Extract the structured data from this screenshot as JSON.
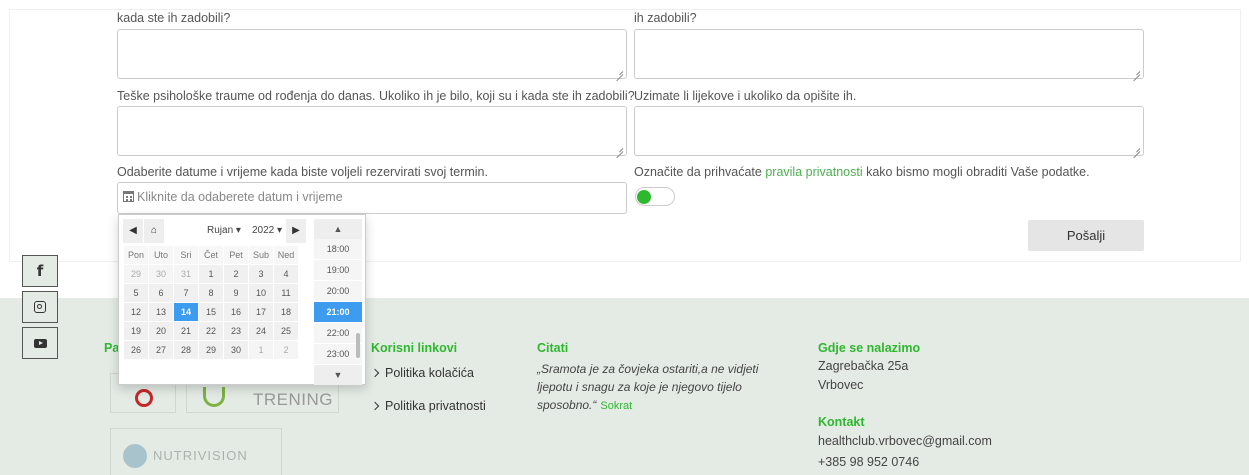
{
  "form": {
    "label_1": "kada ste ih zadobili?",
    "label_2": "ih zadobili?",
    "label_3": "Teške psihološke traume od rođenja do danas. Ukoliko ih je bilo, koji su i kada ste ih zadobili?",
    "label_4": "Uzimate li lijekove i ukoliko da opišite ih.",
    "date_label": "Odaberite datume i vrijeme kada biste voljeli rezervirati svoj termin.",
    "date_placeholder": "Kliknite da odaberete datum i vrijeme",
    "privacy_pre": "Označite da prihvaćate",
    "privacy_link": "pravila privatnosti",
    "privacy_post": "kako bismo mogli obraditi Vaše podatke.",
    "toggle_on": true,
    "submit_label": "Pošalji"
  },
  "datepicker": {
    "month": "Rujan",
    "year": "2022",
    "weekdays": [
      "Pon",
      "Uto",
      "Sri",
      "Čet",
      "Pet",
      "Sub",
      "Ned"
    ],
    "weeks": [
      [
        "29",
        "30",
        "31",
        "1",
        "2",
        "3",
        "4"
      ],
      [
        "5",
        "6",
        "7",
        "8",
        "9",
        "10",
        "11"
      ],
      [
        "12",
        "13",
        "14",
        "15",
        "16",
        "17",
        "18"
      ],
      [
        "19",
        "20",
        "21",
        "22",
        "23",
        "24",
        "25"
      ],
      [
        "26",
        "27",
        "28",
        "29",
        "30",
        "1",
        "2"
      ]
    ],
    "selected_day": "14",
    "times": [
      "18:00",
      "19:00",
      "20:00",
      "21:00",
      "22:00",
      "23:00"
    ],
    "selected_time": "21:00"
  },
  "social": [
    "facebook-icon",
    "instagram-icon",
    "youtube-icon"
  ],
  "footer": {
    "partners_heading": "Pa",
    "links_heading": "Korisni linkovi",
    "links": [
      "Politika kolačića",
      "Politika privatnosti"
    ],
    "quotes_heading": "Citati",
    "quote": "„Sramota je za čovjeka ostariti,a ne vidjeti ljepotu i snagu za koje je njegovo tijelo sposobno.“",
    "quote_author": "Sokrat",
    "location_heading": "Gdje se nalazimo",
    "address_1": "Zagrebačka 25a",
    "address_2": "Vrbovec",
    "contact_heading": "Kontakt",
    "email": "healthclub.vrbovec@gmail.com",
    "phone": "+385 98 952 0746",
    "logo_trening": "TRENING",
    "logo_nutrivision": "NUTRIVISION"
  },
  "colors": {
    "accent": "#2eb82e",
    "selected": "#3d9cf0",
    "footer_bg": "#e4ebe5"
  }
}
